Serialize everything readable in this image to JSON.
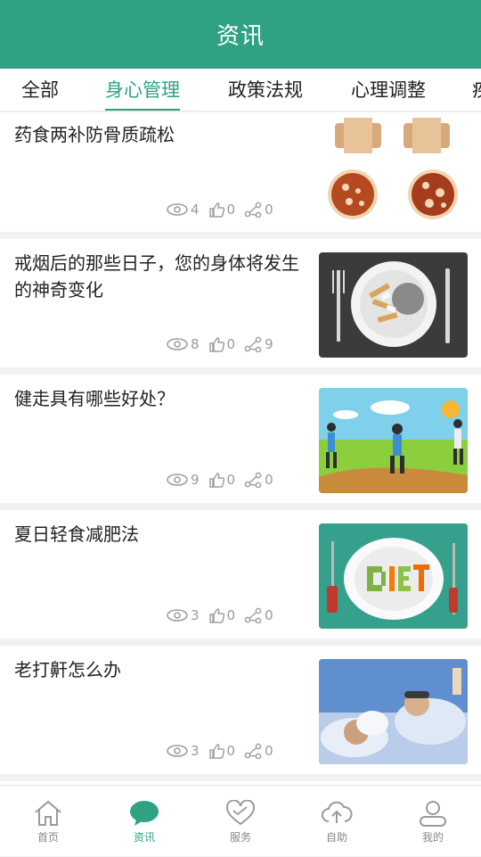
{
  "header": {
    "title": "资讯"
  },
  "tabs": [
    {
      "label": "全部"
    },
    {
      "label": "身心管理"
    },
    {
      "label": "政策法规"
    },
    {
      "label": "心理调整"
    },
    {
      "label": "疾"
    }
  ],
  "active_tab": "身心管理",
  "articles": [
    {
      "title": "药食两补防骨质疏松",
      "views": "4",
      "likes": "0",
      "shares": "0",
      "image": "bone-structure-image"
    },
    {
      "title": "戒烟后的那些日子，您的身体将发生的神奇变化",
      "views": "8",
      "likes": "0",
      "shares": "9",
      "image": "cigarette-plate-image"
    },
    {
      "title": "健走具有哪些好处？",
      "views": "9",
      "likes": "0",
      "shares": "0",
      "image": "walking-people-image"
    },
    {
      "title": "夏日轻食减肥法",
      "views": "3",
      "likes": "0",
      "shares": "0",
      "image": "diet-plate-image"
    },
    {
      "title": "老打鼾怎么办",
      "views": "3",
      "likes": "0",
      "shares": "0",
      "image": "snoring-couple-image"
    }
  ],
  "bottom_nav": [
    {
      "label": "首页",
      "icon": "home-icon"
    },
    {
      "label": "资讯",
      "icon": "chat-bubble-icon"
    },
    {
      "label": "服务",
      "icon": "heart-icon"
    },
    {
      "label": "自助",
      "icon": "cloud-upload-icon"
    },
    {
      "label": "我的",
      "icon": "user-icon"
    }
  ],
  "colors": {
    "brand": "#2fa283",
    "text": "#222222",
    "muted": "#9a9a9a"
  }
}
